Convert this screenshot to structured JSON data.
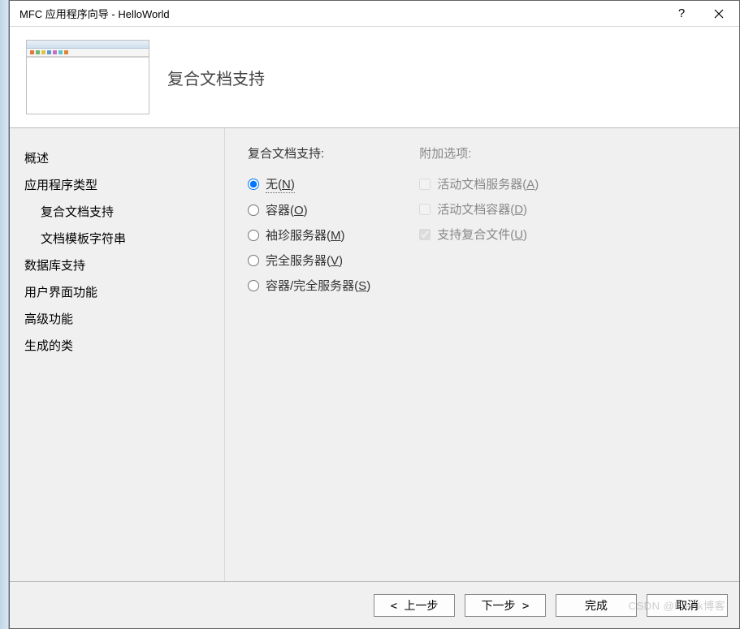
{
  "window": {
    "title": "MFC 应用程序向导 - HelloWorld",
    "help_symbol": "?",
    "close_symbol": "✕"
  },
  "header": {
    "title": "复合文档支持"
  },
  "sidebar": {
    "items": [
      {
        "label": "概述",
        "indent": 0
      },
      {
        "label": "应用程序类型",
        "indent": 0
      },
      {
        "label": "复合文档支持",
        "indent": 1
      },
      {
        "label": "文档模板字符串",
        "indent": 1
      },
      {
        "label": "数据库支持",
        "indent": 0
      },
      {
        "label": "用户界面功能",
        "indent": 0
      },
      {
        "label": "高级功能",
        "indent": 0
      },
      {
        "label": "生成的类",
        "indent": 0
      }
    ]
  },
  "main": {
    "group_label": "复合文档支持:",
    "radios": [
      {
        "label": "无(",
        "mnemonic": "N",
        "suffix": ")",
        "selected": true
      },
      {
        "label": "容器(",
        "mnemonic": "O",
        "suffix": ")",
        "selected": false
      },
      {
        "label": "袖珍服务器(",
        "mnemonic": "M",
        "suffix": ")",
        "selected": false
      },
      {
        "label": "完全服务器(",
        "mnemonic": "V",
        "suffix": ")",
        "selected": false
      },
      {
        "label": "容器/完全服务器(",
        "mnemonic": "S",
        "suffix": ")",
        "selected": false
      }
    ]
  },
  "options": {
    "group_label": "附加选项:",
    "checks": [
      {
        "label": "活动文档服务器(",
        "mnemonic": "A",
        "suffix": ")",
        "checked": false,
        "disabled": true
      },
      {
        "label": "活动文档容器(",
        "mnemonic": "D",
        "suffix": ")",
        "checked": false,
        "disabled": true
      },
      {
        "label": "支持复合文件(",
        "mnemonic": "U",
        "suffix": ")",
        "checked": true,
        "disabled": true
      }
    ]
  },
  "footer": {
    "prev": "上一步",
    "next": "下一步",
    "finish": "完成",
    "cancel": "取消"
  },
  "watermark": "CSDN @Frank博客"
}
